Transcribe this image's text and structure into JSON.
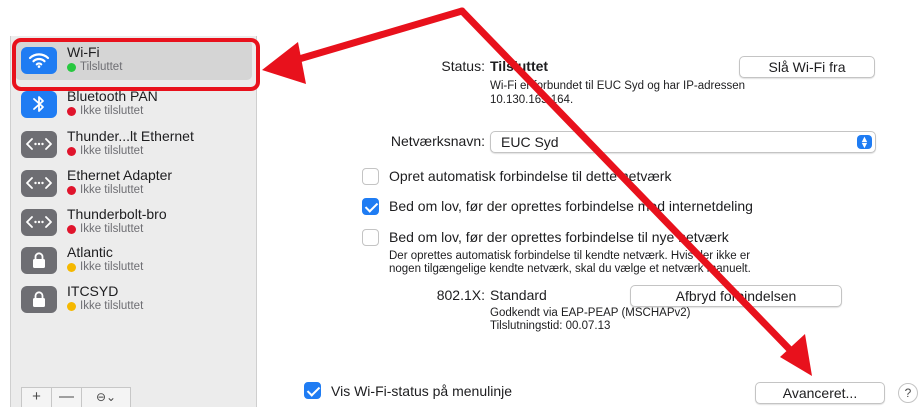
{
  "sidebar": {
    "items": [
      {
        "name": "Wi-Fi",
        "status": "Tilsluttet",
        "icon": "wifi-icon",
        "status_color": "#28c840"
      },
      {
        "name": "Bluetooth PAN",
        "status": "Ikke tilsluttet",
        "icon": "bluetooth-icon",
        "status_color": "#e0142c"
      },
      {
        "name": "Thunder...lt Ethernet",
        "status": "Ikke tilsluttet",
        "icon": "ethernet-arrows-icon",
        "status_color": "#e0142c"
      },
      {
        "name": "Ethernet Adapter",
        "status": "Ikke tilsluttet",
        "icon": "ethernet-arrows-icon",
        "status_color": "#e0142c"
      },
      {
        "name": "Thunderbolt-bro",
        "status": "Ikke tilsluttet",
        "icon": "ethernet-arrows-icon",
        "status_color": "#e0142c"
      },
      {
        "name": "Atlantic",
        "status": "Ikke tilsluttet",
        "icon": "lock-icon",
        "status_color": "#f5b800"
      },
      {
        "name": "ITCSYD",
        "status": "Ikke tilsluttet",
        "icon": "lock-icon",
        "status_color": "#f5b800"
      }
    ],
    "toolbar": {
      "add": "+",
      "remove": "—",
      "more": "⊖⌄"
    }
  },
  "main": {
    "status_label": "Status:",
    "status_value": "Tilsluttet",
    "wifi_off_button": "Slå Wi-Fi fra",
    "status_desc_line1": "Wi-Fi er forbundet til EUC Syd og har IP-adressen",
    "status_desc_line2": "10.130.165.164.",
    "network_name_label": "Netværksnavn:",
    "network_name_value": "EUC Syd",
    "options": [
      {
        "label": "Opret automatisk forbindelse til dette netværk",
        "checked": false
      },
      {
        "label": "Bed om lov, før der oprettes forbindelse med internetdeling",
        "checked": true
      },
      {
        "label": "Bed om lov, før der oprettes forbindelse til nye netværk",
        "checked": false
      }
    ],
    "info_line1": "Der oprettes automatisk forbindelse til kendte netværk. Hvis der ikke er",
    "info_line2": "nogen tilgængelige kendte netværk, skal du vælge et netværk manuelt.",
    "dot1x_label": "802.1X:",
    "dot1x_value": "Standard",
    "disconnect_button": "Afbryd forbindelsen",
    "auth_line": "Godkendt via EAP-PEAP (MSCHAPv2)",
    "connect_time_line": "Tilslutningstid: 00.07.13",
    "show_status_label": "Vis Wi-Fi-status på menulinje",
    "show_status_checked": true,
    "advanced_button": "Avanceret...",
    "help_button": "?"
  },
  "colors": {
    "accent": "#1f7cf3",
    "annotation": "#e8111c"
  }
}
